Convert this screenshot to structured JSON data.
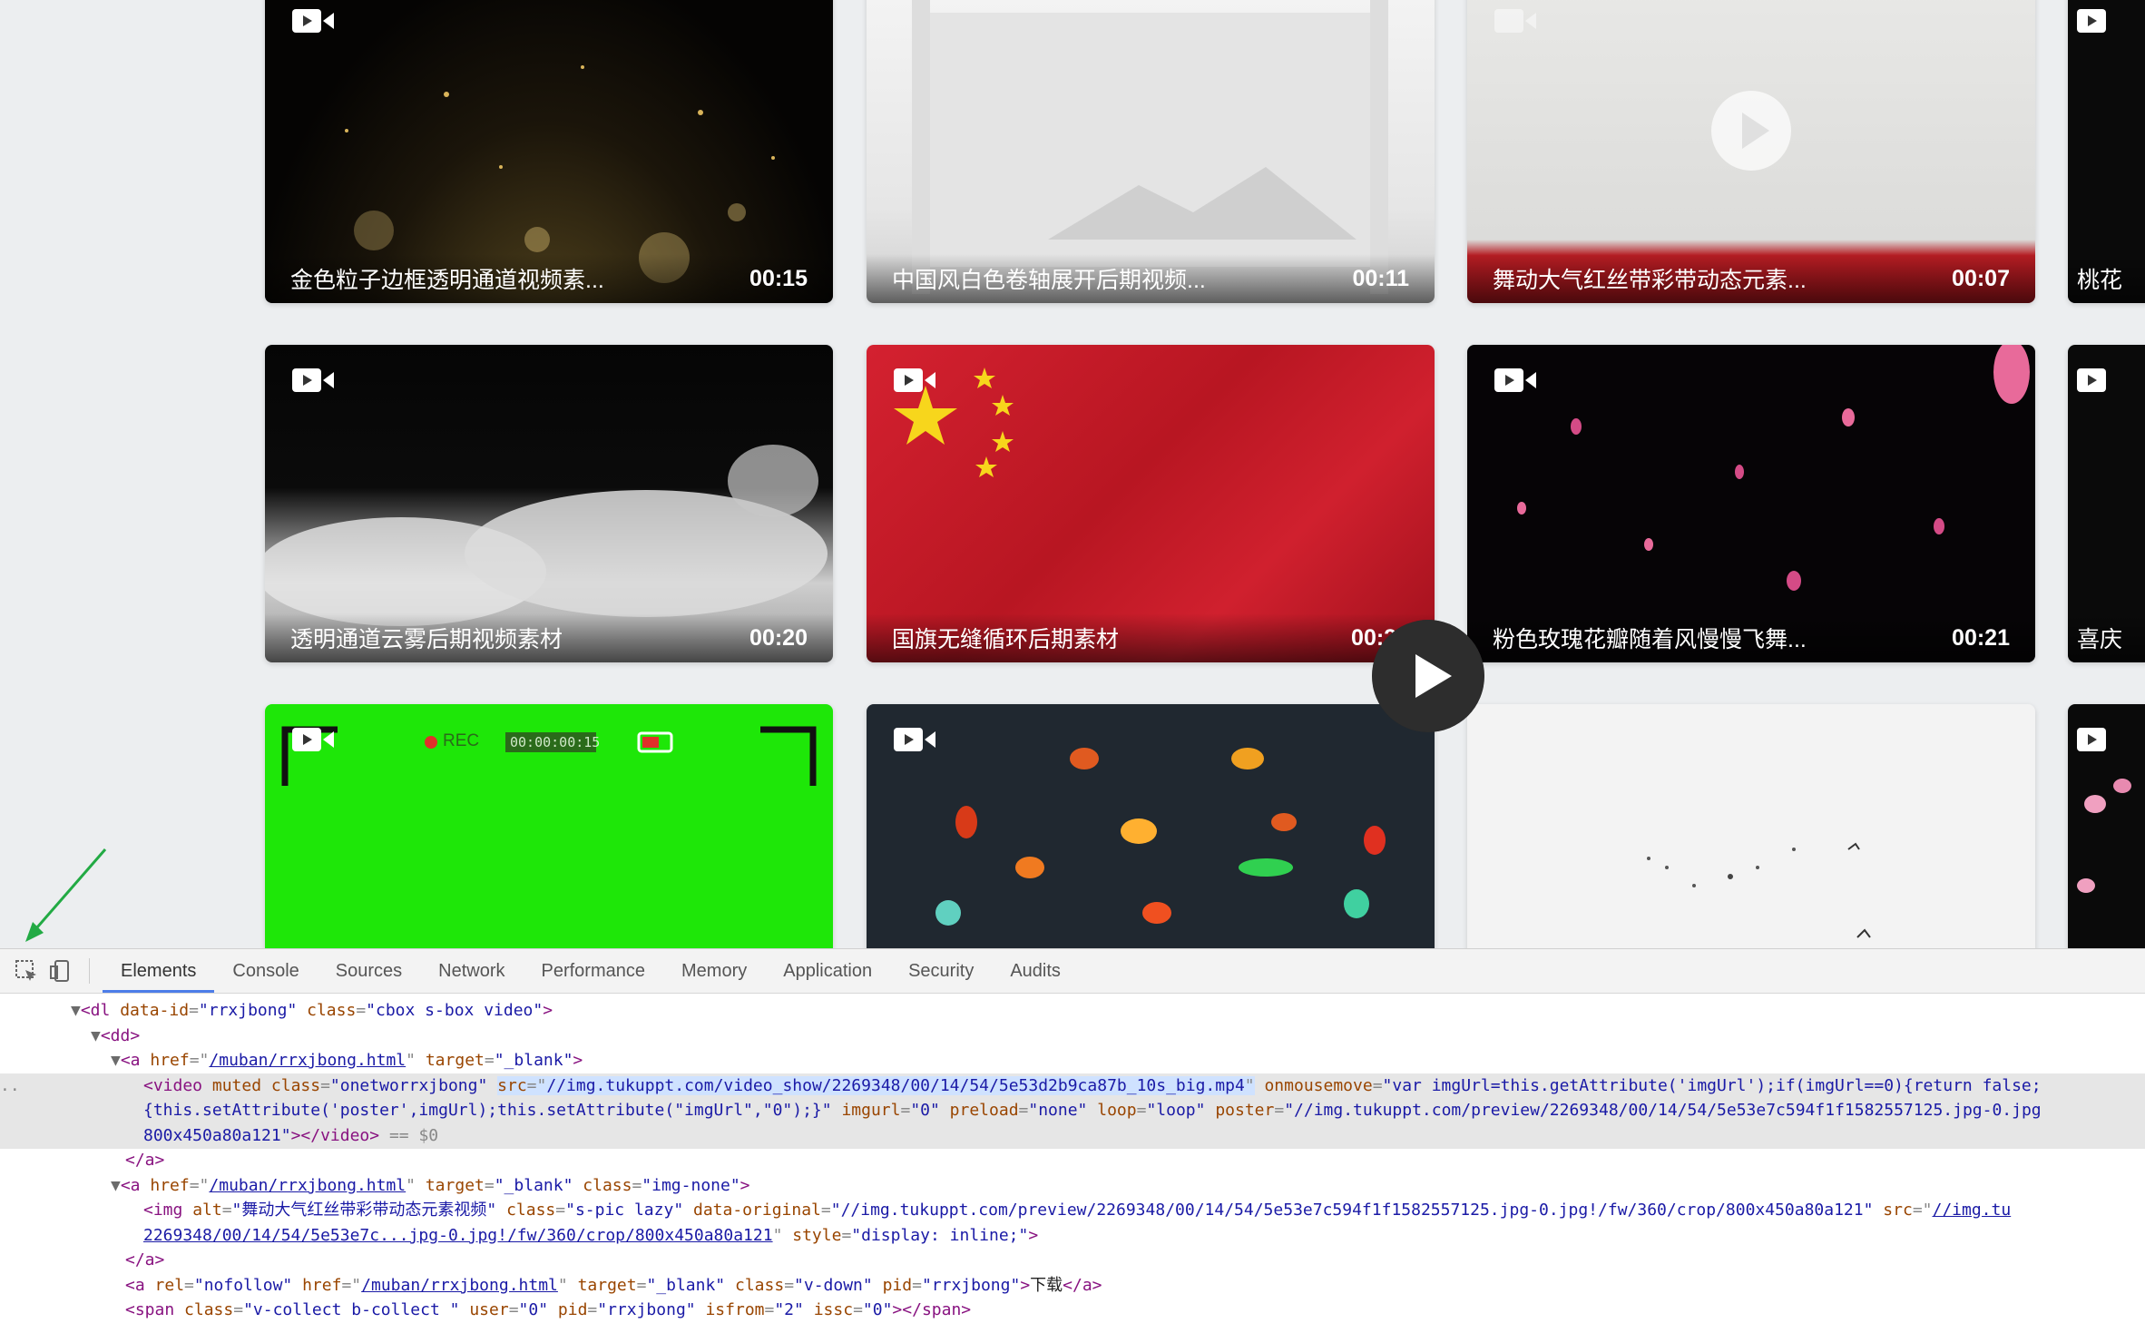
{
  "videos": [
    {
      "title": "金色粒子边框透明通道视频素...",
      "duration": "00:15"
    },
    {
      "title": "中国风白色卷轴展开后期视频...",
      "duration": "00:11"
    },
    {
      "title": "舞动大气红丝带彩带动态元素...",
      "duration": "00:07"
    },
    {
      "title": "桃花",
      "duration": ""
    },
    {
      "title": "透明通道云雾后期视频素材",
      "duration": "00:20"
    },
    {
      "title": "国旗无缝循环后期素材",
      "duration": "00:20"
    },
    {
      "title": "粉色玫瑰花瓣随着风慢慢飞舞...",
      "duration": "00:21"
    },
    {
      "title": "喜庆",
      "duration": ""
    }
  ],
  "green_card": {
    "rec": "REC",
    "timecode": "00:00:00:15"
  },
  "devtools": {
    "tabs": [
      "Elements",
      "Console",
      "Sources",
      "Network",
      "Performance",
      "Memory",
      "Application",
      "Security",
      "Audits"
    ],
    "lines": {
      "l1": {
        "tag": "<dl ",
        "a1n": "data-id",
        "a1v": "\"rrxjbong\"",
        "a2n": "class",
        "a2v": "\"cbox s-box video\"",
        "end": ">"
      },
      "l2": {
        "text": "<dd>"
      },
      "l3": {
        "tag": "<a ",
        "a1n": "href",
        "a1v": "/muban/rrxjbong.html",
        "a2n": "target",
        "a2v": "\"_blank\"",
        "end": ">"
      },
      "l4": {
        "tag": "<video ",
        "a0": "muted ",
        "a1n": "class",
        "a1v": "\"onetworrxjbong\"",
        "a2n": "src",
        "a2v": "//img.tukuppt.com/video_show/2269348/00/14/54/5e53d2b9ca87b_10s_big.mp4",
        "a3n": "onmousemove",
        "a3v": "\"var imgUrl=this.getAttribute('imgUrl');if(imgUrl==0){return false;"
      },
      "l5": {
        "text": "{this.setAttribute('poster',imgUrl);this.setAttribute(\"imgUrl\",\"0\");}\"",
        "a1n": "imgurl",
        "a1v": "\"0\"",
        "a2n": "preload",
        "a2v": "\"none\"",
        "a3n": "loop",
        "a3v": "\"loop\"",
        "a4n": "poster",
        "a4v": "\"//img.tukuppt.com/preview/2269348/00/14/54/5e53e7c594f1f1582557125.jpg-0.jpg"
      },
      "l6": {
        "text": "800x450a80a121\"",
        "end": "></video>",
        "eq": " == $0"
      },
      "l7": {
        "text": "</a>"
      },
      "l8": {
        "tag": "<a ",
        "a1n": "href",
        "a1v": "/muban/rrxjbong.html",
        "a2n": "target",
        "a2v": "\"_blank\"",
        "a3n": "class",
        "a3v": "\"img-none\"",
        "end": ">"
      },
      "l9": {
        "tag": "<img ",
        "a1n": "alt",
        "a1v": "\"舞动大气红丝带彩带动态元素视频\"",
        "a2n": "class",
        "a2v": "\"s-pic lazy\"",
        "a3n": "data-original",
        "a3v": "\"//img.tukuppt.com/preview/2269348/00/14/54/5e53e7c594f1f1582557125.jpg-0.jpg!/fw/360/crop/800x450a80a121\"",
        "a4n": "src",
        "a4v": "//img.tu"
      },
      "l10": {
        "a1v": "2269348/00/14/54/5e53e7c...jpg-0.jpg!/fw/360/crop/800x450a80a121",
        "a2n": "style",
        "a2v": "\"display: inline;\"",
        "end": ">"
      },
      "l11": {
        "text": "</a>"
      },
      "l12": {
        "tag": "<a ",
        "a1n": "rel",
        "a1v": "\"nofollow\"",
        "a2n": "href",
        "a2v": "/muban/rrxjbong.html",
        "a3n": "target",
        "a3v": "\"_blank\"",
        "a4n": "class",
        "a4v": "\"v-down\"",
        "a5n": "pid",
        "a5v": "\"rrxjbong\"",
        "end": ">",
        "inner": "下载",
        "close": "</a>"
      },
      "l13": {
        "tag": "<span ",
        "a1n": "class",
        "a1v": "\"v-collect b-collect \"",
        "a2n": "user",
        "a2v": "\"0\"",
        "a3n": "pid",
        "a3v": "\"rrxjbong\"",
        "a4n": "isfrom",
        "a4v": "\"2\"",
        "a5n": "issc",
        "a5v": "\"0\"",
        "end": ">",
        "close": "</span>"
      }
    }
  },
  "colors": {
    "accent": "#4d7de8",
    "arrow": "#22aa44"
  }
}
